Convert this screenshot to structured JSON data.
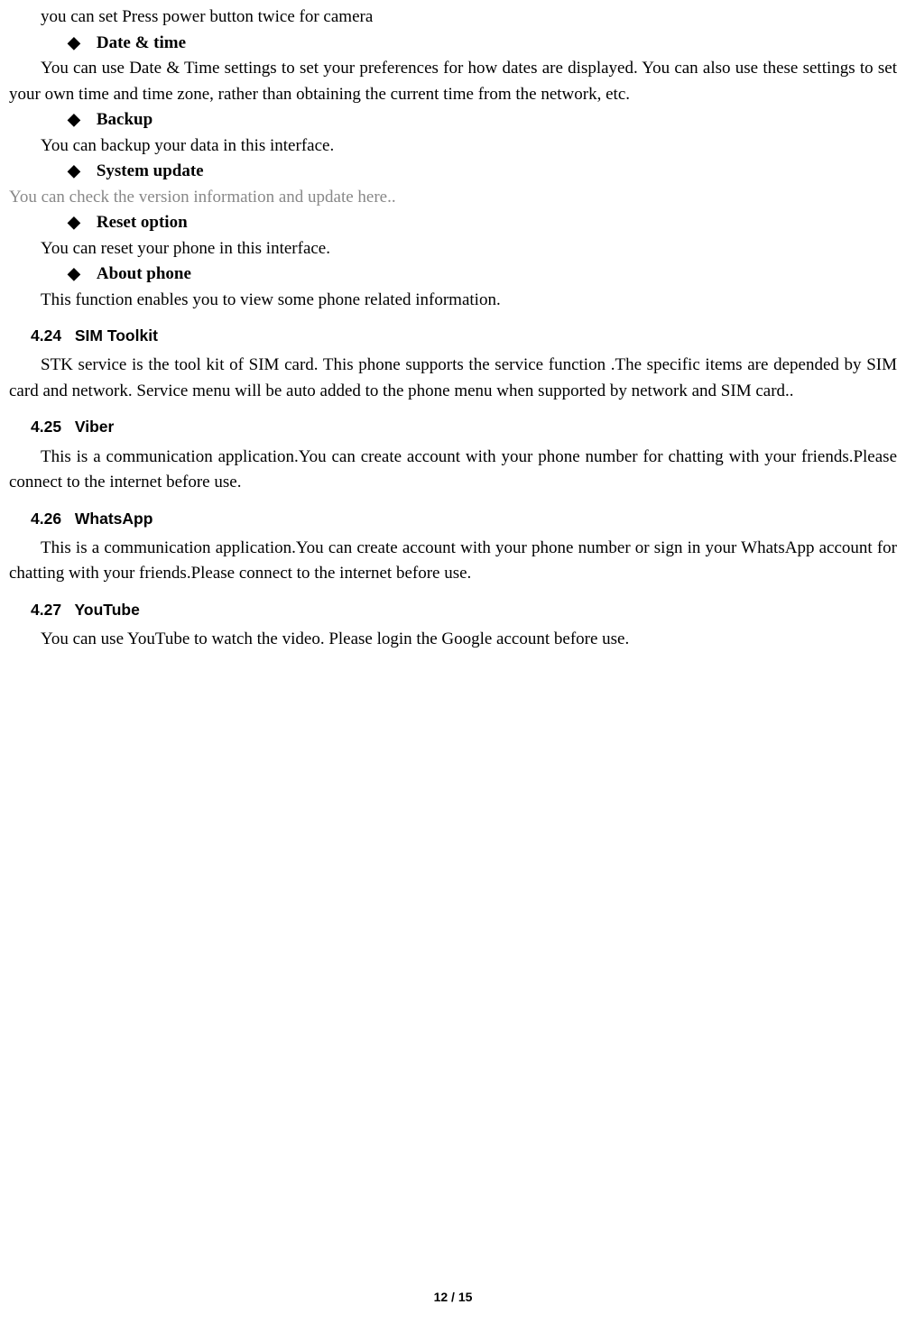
{
  "intro": "you can set Press power button twice for camera",
  "bullets": [
    {
      "title": "Date & time",
      "body": "You can use Date & Time settings to set your preferences for how dates are displayed. You can also use these settings to set your own time and time zone, rather than obtaining the current time from the network, etc.",
      "grey": false
    },
    {
      "title": "Backup",
      "body": "You can backup your data in this interface.",
      "grey": false
    },
    {
      "title": "System update",
      "body": "You can check the version information and update here..",
      "grey": true
    },
    {
      "title": "Reset option",
      "body": "You can reset your phone in this interface.",
      "grey": false
    },
    {
      "title": "About phone",
      "body": "This function enables you to view some phone related information.",
      "grey": false
    }
  ],
  "sections": [
    {
      "num": "4.24",
      "title": "SIM Toolkit",
      "body": "STK service is the tool kit of SIM card. This phone supports the service function .The specific items are depended by SIM card and network. Service menu will be auto added to the phone menu when supported by network and SIM card.."
    },
    {
      "num": "4.25",
      "title": "Viber",
      "body": "This is a communication application.You can create account with your phone number for chatting with your friends.Please connect to the internet before use."
    },
    {
      "num": "4.26",
      "title": "WhatsApp",
      "body": "This is a communication application.You can create account with your phone number or sign in your WhatsApp account for chatting with your friends.Please connect to the internet before use."
    },
    {
      "num": "4.27",
      "title": "YouTube",
      "body": "You can use YouTube to watch the video. Please login the Google account before use."
    }
  ],
  "pageNumber": "12 / 15"
}
